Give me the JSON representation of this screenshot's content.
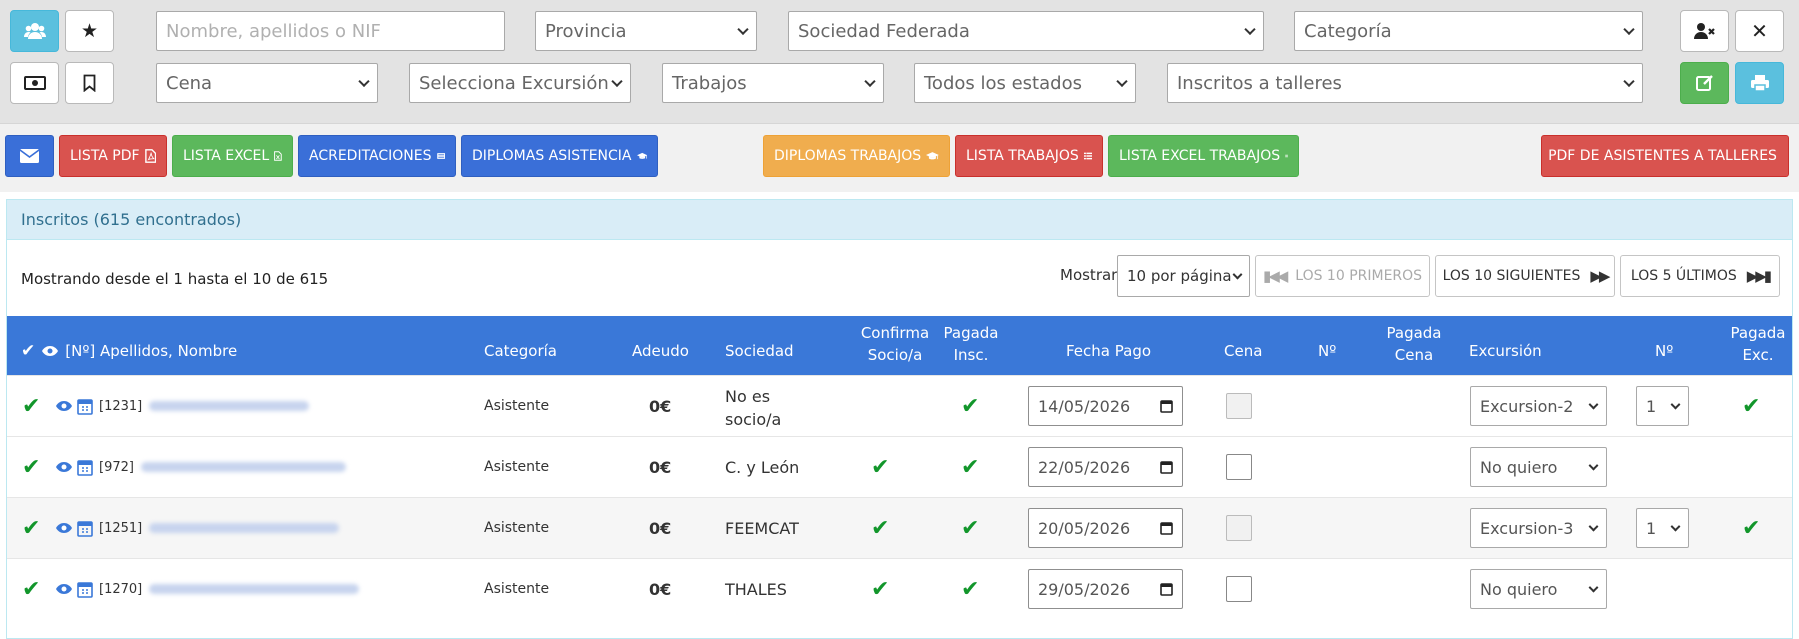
{
  "filters": {
    "search_placeholder": "Nombre, apellidos o NIF",
    "provincia": "Provincia",
    "sociedad": "Sociedad Federada",
    "categoria": "Categoría",
    "cena": "Cena",
    "excursion": "Selecciona Excursión",
    "trabajos": "Trabajos",
    "estados": "Todos los estados",
    "talleres": "Inscritos a talleres"
  },
  "toolbar": {
    "lista_pdf": "LISTA PDF",
    "lista_excel": "LISTA EXCEL",
    "acreditaciones": "ACREDITACIONES",
    "diplomas_asistencia": "DIPLOMAS ASISTENCIA",
    "diplomas_trabajos": "DIPLOMAS TRABAJOS",
    "lista_trabajos": "LISTA TRABAJOS",
    "lista_excel_trabajos": "LISTA EXCEL TRABAJOS",
    "pdf_talleres": "PDF DE ASISTENTES A TALLERES"
  },
  "panel": {
    "title": "Inscritos (615 encontrados)",
    "showing": "Mostrando desde el 1 hasta el 10 de 615",
    "mostrar_label": "Mostrar",
    "per_page": "10 por página",
    "first": "LOS 10 PRIMEROS",
    "next": "LOS 10 SIGUIENTES",
    "last": "LOS 5 ÚLTIMOS"
  },
  "table": {
    "headers": {
      "name": "[Nº] Apellidos, Nombre",
      "categoria": "Categoría",
      "adeudo": "Adeudo",
      "sociedad": "Sociedad",
      "confirma_1": "Confirma",
      "confirma_2": "Socio/a",
      "pagada_insc_1": "Pagada",
      "pagada_insc_2": "Insc.",
      "fecha_pago": "Fecha Pago",
      "cena": "Cena",
      "num": "Nº",
      "pagada_cena_1": "Pagada",
      "pagada_cena_2": "Cena",
      "excursion": "Excursión",
      "num2": "Nº",
      "pagada_exc_1": "Pagada",
      "pagada_exc_2": "Exc."
    },
    "rows": [
      {
        "num": "[1231]",
        "categoria": "Asistente",
        "adeudo": "0€",
        "sociedad": "No es socio/a",
        "fecha": "14/05/2026",
        "excursion": "Excursion-2",
        "exc_num": "1"
      },
      {
        "num": "[972]",
        "categoria": "Asistente",
        "adeudo": "0€",
        "sociedad": "C. y León",
        "fecha": "22/05/2026",
        "excursion": "No quiero",
        "exc_num": ""
      },
      {
        "num": "[1251]",
        "categoria": "Asistente",
        "adeudo": "0€",
        "sociedad": "FEEMCAT",
        "fecha": "20/05/2026",
        "excursion": "Excursion-3",
        "exc_num": "1"
      },
      {
        "num": "[1270]",
        "categoria": "Asistente",
        "adeudo": "0€",
        "sociedad": "THALES",
        "fecha": "29/05/2026",
        "excursion": "No quiero",
        "exc_num": ""
      }
    ]
  }
}
